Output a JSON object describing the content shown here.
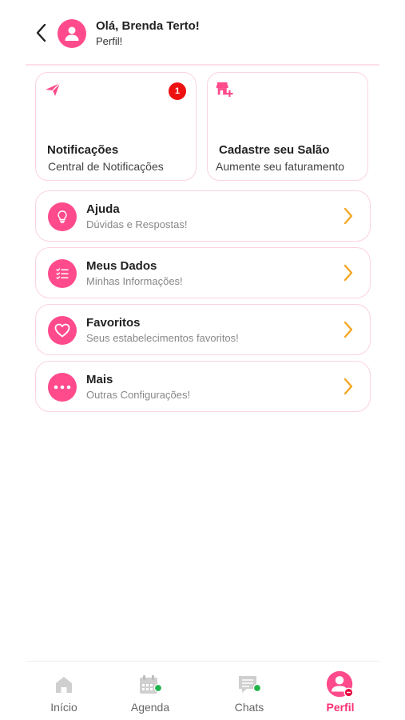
{
  "header": {
    "greeting": "Olá, Brenda Terto!",
    "subtitle": "Perfil!"
  },
  "cards": [
    {
      "title": "Notificações",
      "subtitle": "Central de Notificações",
      "icon": "paper-plane-icon",
      "badge": "1"
    },
    {
      "title": "Cadastre seu Salão",
      "subtitle": "Aumente seu faturamento",
      "icon": "store-add-icon"
    }
  ],
  "menu": [
    {
      "title": "Ajuda",
      "subtitle": "Dúvidas e Respostas!",
      "icon": "lightbulb-icon"
    },
    {
      "title": "Meus Dados",
      "subtitle": "Minhas Informações!",
      "icon": "checklist-icon"
    },
    {
      "title": "Favoritos",
      "subtitle": "Seus estabelecimentos favoritos!",
      "icon": "heart-icon"
    },
    {
      "title": "Mais",
      "subtitle": "Outras Configurações!",
      "icon": "more-dots-icon"
    }
  ],
  "nav": [
    {
      "label": "Início",
      "icon": "home-icon",
      "active": false
    },
    {
      "label": "Agenda",
      "icon": "calendar-icon",
      "active": false
    },
    {
      "label": "Chats",
      "icon": "chat-icon",
      "active": false
    },
    {
      "label": "Perfil",
      "icon": "profile-icon",
      "active": true
    }
  ],
  "colors": {
    "accent": "#ff4b8b",
    "chevron": "#f5a623",
    "badge": "#ee1111",
    "online": "#22b44a",
    "nav_inactive_icon": "#cfcfcf"
  }
}
